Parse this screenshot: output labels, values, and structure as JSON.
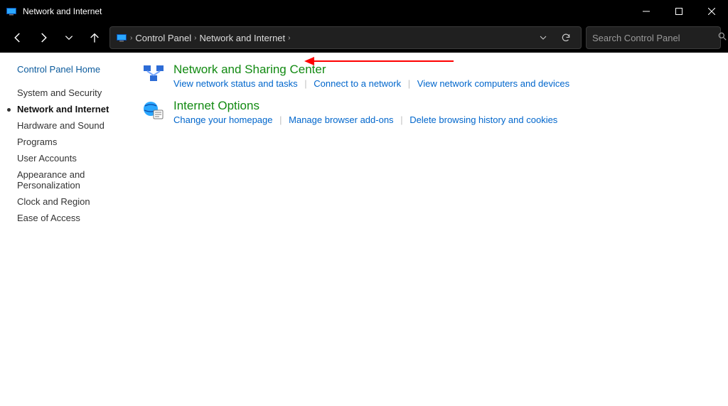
{
  "window": {
    "title": "Network and Internet"
  },
  "address": {
    "crumbs": [
      "Control Panel",
      "Network and Internet"
    ]
  },
  "search": {
    "placeholder": "Search Control Panel"
  },
  "sidebar": {
    "home": "Control Panel Home",
    "items": [
      {
        "label": "System and Security",
        "active": false
      },
      {
        "label": "Network and Internet",
        "active": true
      },
      {
        "label": "Hardware and Sound",
        "active": false
      },
      {
        "label": "Programs",
        "active": false
      },
      {
        "label": "User Accounts",
        "active": false
      },
      {
        "label": "Appearance and Personalization",
        "active": false
      },
      {
        "label": "Clock and Region",
        "active": false
      },
      {
        "label": "Ease of Access",
        "active": false
      }
    ]
  },
  "categories": [
    {
      "title": "Network and Sharing Center",
      "links": [
        "View network status and tasks",
        "Connect to a network",
        "View network computers and devices"
      ]
    },
    {
      "title": "Internet Options",
      "links": [
        "Change your homepage",
        "Manage browser add-ons",
        "Delete browsing history and cookies"
      ]
    }
  ]
}
